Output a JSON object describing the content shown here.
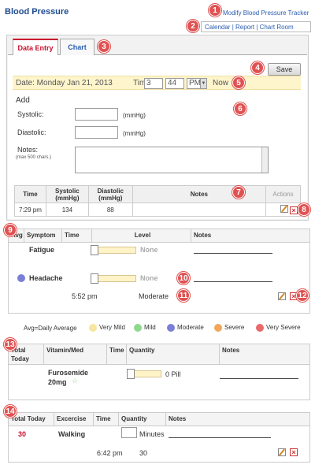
{
  "app": {
    "title": "Blood Pressure",
    "modify_link": "Modify Blood Pressure Tracker"
  },
  "topnav": {
    "items": [
      "Calendar",
      "Report",
      "Chart Room"
    ],
    "sep": "|"
  },
  "tabs": [
    {
      "label": "Data Entry",
      "active": true
    },
    {
      "label": "Chart",
      "active": false
    }
  ],
  "save_label": "Save",
  "datebar": {
    "date_text": "Date: Monday Jan 21, 2013",
    "time_label": "Time:",
    "hour": "3",
    "minute": "44",
    "ampm": "PM",
    "now_label": "Now"
  },
  "add_form": {
    "heading": "Add",
    "systolic_label": "Systolic:",
    "diastolic_label": "Diastolic:",
    "unit": "(mmHg)",
    "notes_label": "Notes:",
    "notes_hint": "(max 500 chars.)"
  },
  "entries_table": {
    "headers": [
      "Time",
      "Systolic\n(mmHg)",
      "Diastolic\n(mmHg)",
      "Notes",
      "Actions"
    ],
    "rows": [
      {
        "time": "7:29 pm",
        "systolic": "134",
        "diastolic": "88",
        "notes": ""
      }
    ]
  },
  "symptoms": {
    "headers": [
      "Avg",
      "Symptom",
      "Time",
      "Level",
      "Notes"
    ],
    "rows": [
      {
        "name": "Fatigue",
        "level_text": "None",
        "avg_color": ""
      },
      {
        "name": "Headache",
        "level_text": "None",
        "avg_color": "#7b7fd6"
      }
    ],
    "log": {
      "time": "5:52 pm",
      "level": "Moderate"
    }
  },
  "legend": {
    "avg_label": "Avg=Daily Average",
    "items": [
      {
        "label": "Very Mild",
        "color": "#f7e6a0"
      },
      {
        "label": "Mild",
        "color": "#8ed98e"
      },
      {
        "label": "Moderate",
        "color": "#7b7fd6"
      },
      {
        "label": "Severe",
        "color": "#f2a65a"
      },
      {
        "label": "Very Severe",
        "color": "#e86a6a"
      }
    ]
  },
  "meds": {
    "headers": [
      "Total\nToday",
      "Vitamin/Med",
      "Time",
      "Quantity",
      "Notes"
    ],
    "rows": [
      {
        "name": "Furosemide 20mg",
        "qty": "0 Pill"
      }
    ]
  },
  "exercise": {
    "headers": [
      "Total Today",
      "Excercise",
      "Time",
      "Quantity",
      "Notes"
    ],
    "rows": [
      {
        "total": "30",
        "name": "Walking",
        "unit": "Minutes"
      }
    ],
    "log": {
      "time": "6:42 pm",
      "qty": "30"
    }
  },
  "badges": [
    "1",
    "2",
    "3",
    "4",
    "5",
    "6",
    "7",
    "8",
    "9",
    "10",
    "11",
    "12",
    "13",
    "14"
  ],
  "colors": {
    "accent_red": "#c8102e",
    "link_blue": "#2a5db0",
    "badge_red": "#e05252",
    "date_bar_bg": "#fff5cc"
  }
}
